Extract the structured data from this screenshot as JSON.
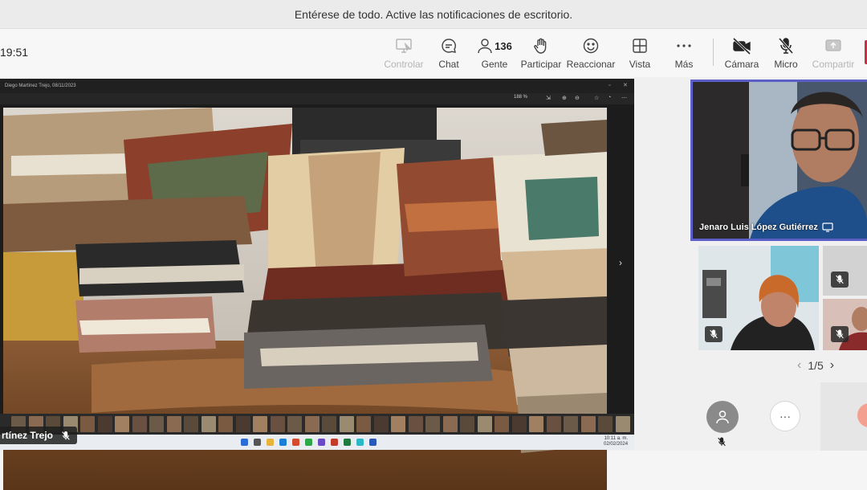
{
  "banner": {
    "text": "Entérese de todo. Active las notificaciones de escritorio."
  },
  "meeting": {
    "timer": "19:51"
  },
  "toolbar": {
    "control_label": "Controlar",
    "chat_label": "Chat",
    "people_label": "Gente",
    "people_count": "136",
    "raise_label": "Participar",
    "react_label": "Reaccionar",
    "view_label": "Vista",
    "more_label": "Más",
    "camera_label": "Cámara",
    "mic_label": "Micro",
    "share_label": "Compartir"
  },
  "shared_screen": {
    "window_title": "Diego Martínez Trejo, 08/11/2023",
    "zoom_level": "188 %",
    "taskbar_time": "10:11 a. m.",
    "taskbar_date": "02/02/2024"
  },
  "presenter": {
    "name": "rtínez Trejo"
  },
  "participants": {
    "main_name": "Jenaro Luis López Gutiérrez"
  },
  "pager": {
    "current": "1/5"
  },
  "colors": {
    "accent": "#5b5fc7",
    "leave": "#c4314b"
  },
  "icons": {
    "control": "screen-control-icon",
    "chat": "chat-icon",
    "people": "people-icon",
    "raise": "raise-hand-icon",
    "react": "smiley-icon",
    "view": "grid-icon",
    "more": "more-dots-icon",
    "camera": "camera-off-icon",
    "mic": "mic-off-icon",
    "share": "share-screen-icon"
  }
}
